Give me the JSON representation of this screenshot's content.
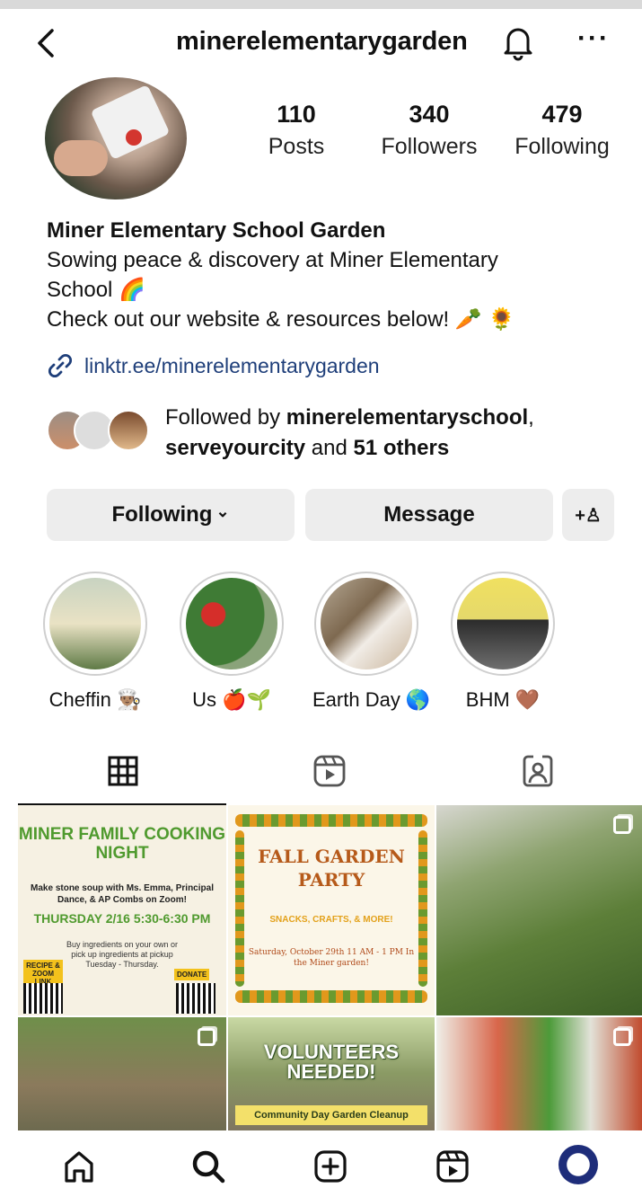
{
  "header": {
    "username": "minerelementarygarden",
    "more_label": "···"
  },
  "profile": {
    "stats": {
      "posts_count": "110",
      "posts_label": "Posts",
      "followers_count": "340",
      "followers_label": "Followers",
      "following_count": "479",
      "following_label": "Following"
    },
    "name": "Miner Elementary School Garden",
    "bio_line1": "Sowing peace & discovery at Miner Elementary",
    "bio_line2": "School 🌈",
    "bio_line3": "Check out our website & resources below! 🥕 🌻",
    "link": "linktr.ee/minerelementarygarden",
    "followed_by_prefix": "Followed by ",
    "followed_by_user1": "minerelementaryschool",
    "followed_by_sep": ",",
    "followed_by_user2": "serveyourcity",
    "followed_by_and": " and ",
    "followed_by_others": "51 others"
  },
  "actions": {
    "following_label": "Following",
    "following_chevron": "⌄",
    "message_label": "Message",
    "add_person_label": "+♙"
  },
  "highlights": [
    {
      "label": "Cheffin 👨🏽‍🍳"
    },
    {
      "label": "Us 🍎🌱"
    },
    {
      "label": "Earth Day 🌎"
    },
    {
      "label": "BHM 🤎"
    }
  ],
  "posts": {
    "p1": {
      "title": "MINER FAMILY COOKING NIGHT",
      "subtitle": "Make stone soup with Ms. Emma, Principal Dance, & AP Combs on Zoom!",
      "date": "THURSDAY 2/16 5:30-6:30 PM",
      "info": "Buy ingredients on your own or pick up ingredients at pickup Tuesday - Thursday.",
      "tag_recipe": "RECIPE & ZOOM LINK",
      "tag_donate": "DONATE"
    },
    "p2": {
      "title": "FALL GARDEN PARTY",
      "subtitle": "SNACKS, CRAFTS, & MORE!",
      "details": "Saturday, October 29th 11 AM - 1 PM In the Miner garden!"
    },
    "p5": {
      "title": "VOLUNTEERS NEEDED!",
      "banner": "Community Day Garden Cleanup"
    }
  },
  "icons": {
    "back": "back-arrow-icon",
    "bell": "bell-icon",
    "more": "more-icon",
    "link": "link-icon",
    "grid": "grid-icon",
    "reels": "reels-icon",
    "tagged": "tagged-icon",
    "home": "home-icon",
    "search": "search-icon",
    "create": "create-icon",
    "profile": "profile-avatar-icon"
  },
  "colors": {
    "link": "#1f3f7a",
    "button_bg": "#ededed",
    "text": "#111111"
  }
}
